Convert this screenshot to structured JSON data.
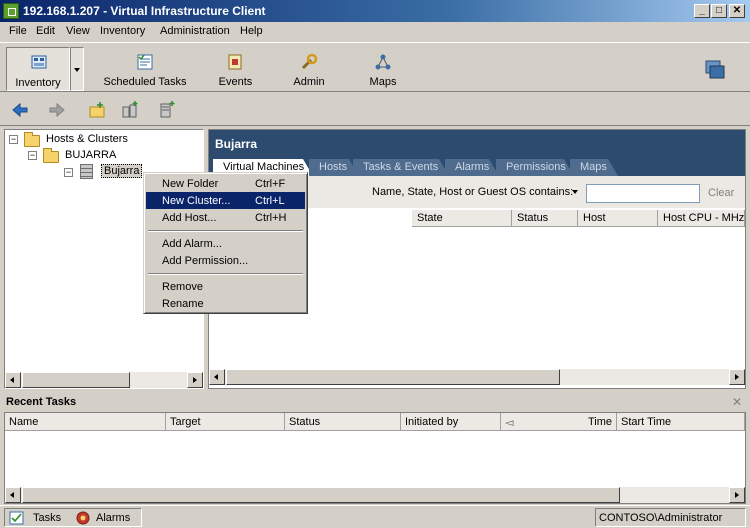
{
  "window": {
    "title": "192.168.1.207 - Virtual Infrastructure Client",
    "minimize": "_",
    "maximize": "□",
    "close": "✕"
  },
  "menu": [
    "File",
    "Edit",
    "View",
    "Inventory",
    "Administration",
    "Help"
  ],
  "nav": {
    "inventory": "Inventory",
    "scheduled_tasks": "Scheduled Tasks",
    "events": "Events",
    "admin": "Admin",
    "maps": "Maps"
  },
  "tree": {
    "root": "Hosts & Clusters",
    "datacenter_folder": "BUJARRA",
    "datacenter": "Bujarra",
    "collapse_glyph": "−"
  },
  "context_menu": {
    "items": [
      {
        "label": "New Folder",
        "shortcut": "Ctrl+F"
      },
      {
        "label": "New Cluster...",
        "shortcut": "Ctrl+L"
      },
      {
        "label": "Add Host...",
        "shortcut": "Ctrl+H"
      },
      {
        "label": "Add Alarm..."
      },
      {
        "label": "Add Permission..."
      },
      {
        "label": "Remove"
      },
      {
        "label": "Rename"
      }
    ]
  },
  "right_pane": {
    "title": "Bujarra",
    "tabs": [
      "Virtual Machines",
      "Hosts",
      "Tasks & Events",
      "Alarms",
      "Permissions",
      "Maps"
    ],
    "filter_label": "Name, State, Host or Guest OS contains:",
    "filter_value": "",
    "clear": "Clear",
    "columns": [
      "State",
      "Status",
      "Host",
      "Host CPU - MHz"
    ]
  },
  "recent_tasks": {
    "title": "Recent Tasks",
    "close": "✕",
    "columns": [
      "Name",
      "Target",
      "Status",
      "Initiated by",
      "Time",
      "Start Time"
    ]
  },
  "statusbar": {
    "tasks": "Tasks",
    "alarms": "Alarms",
    "user": "CONTOSO\\Administrator"
  },
  "colors": {
    "title_bar": "#0a246a",
    "header_bg": "#2d4b6e",
    "highlight": "#0a246a"
  }
}
